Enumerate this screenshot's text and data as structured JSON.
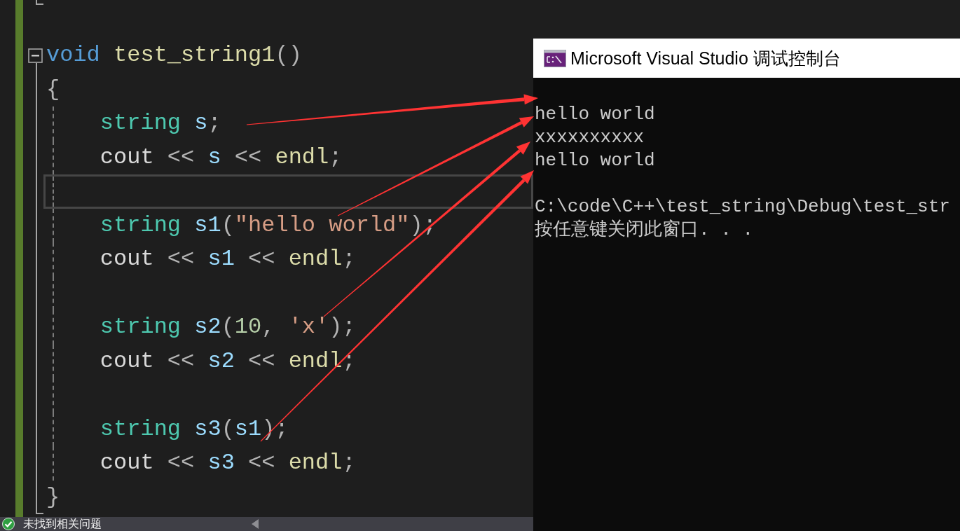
{
  "editor": {
    "lines": [
      {
        "kind": "fold_end",
        "current": false
      },
      {
        "kind": "code",
        "current": false
      },
      {
        "kind": "fold_start",
        "expanded": true,
        "tokens": [
          {
            "kind": "keyword",
            "text": "void"
          },
          {
            "kind": "function",
            "text": " test_string1"
          },
          {
            "kind": "punct",
            "text": "()"
          }
        ],
        "current": false
      },
      {
        "kind": "code",
        "tokens": [
          {
            "kind": "punct",
            "text": "{"
          }
        ],
        "current": false,
        "children": [
          {
            "kind": "code",
            "tokens": [
              {
                "kind": "type",
                "text": "string"
              },
              {
                "kind": "variable",
                "text": " s"
              },
              {
                "kind": "punct",
                "text": ";"
              }
            ],
            "current": false
          },
          {
            "kind": "code",
            "tokens": [
              {
                "kind": "identifier",
                "text": "cout"
              },
              {
                "kind": "operator",
                "text": " << "
              },
              {
                "kind": "variable",
                "text": "s"
              },
              {
                "kind": "operator",
                "text": " << "
              },
              {
                "kind": "function",
                "text": "endl"
              },
              {
                "kind": "punct",
                "text": ";"
              }
            ],
            "current": false
          },
          {
            "kind": "code",
            "current": true
          },
          {
            "kind": "code",
            "tokens": [
              {
                "kind": "type",
                "text": "string"
              },
              {
                "kind": "variable",
                "text": " s1"
              },
              {
                "kind": "punct",
                "text": "("
              },
              {
                "kind": "string",
                "text": "\"hello world\""
              },
              {
                "kind": "punct",
                "text": ");"
              }
            ],
            "current": false
          },
          {
            "kind": "code",
            "tokens": [
              {
                "kind": "identifier",
                "text": "cout"
              },
              {
                "kind": "operator",
                "text": " << "
              },
              {
                "kind": "variable",
                "text": "s1"
              },
              {
                "kind": "operator",
                "text": " << "
              },
              {
                "kind": "function",
                "text": "endl"
              },
              {
                "kind": "punct",
                "text": ";"
              }
            ],
            "current": false
          },
          {
            "kind": "code",
            "current": false
          },
          {
            "kind": "code",
            "tokens": [
              {
                "kind": "type",
                "text": "string"
              },
              {
                "kind": "variable",
                "text": " s2"
              },
              {
                "kind": "punct",
                "text": "("
              },
              {
                "kind": "number",
                "text": "10"
              },
              {
                "kind": "punct",
                "text": ", "
              },
              {
                "kind": "string",
                "text": "'x'"
              },
              {
                "kind": "punct",
                "text": ");"
              }
            ],
            "current": false
          },
          {
            "kind": "code",
            "tokens": [
              {
                "kind": "identifier",
                "text": "cout"
              },
              {
                "kind": "operator",
                "text": " << "
              },
              {
                "kind": "variable",
                "text": "s2"
              },
              {
                "kind": "operator",
                "text": " << "
              },
              {
                "kind": "function",
                "text": "endl"
              },
              {
                "kind": "punct",
                "text": ";"
              }
            ],
            "current": false
          },
          {
            "kind": "code",
            "current": false
          },
          {
            "kind": "code",
            "tokens": [
              {
                "kind": "type",
                "text": "string"
              },
              {
                "kind": "variable",
                "text": " s3"
              },
              {
                "kind": "punct",
                "text": "("
              },
              {
                "kind": "variable",
                "text": "s1"
              },
              {
                "kind": "punct",
                "text": ");"
              }
            ],
            "current": false
          },
          {
            "kind": "code",
            "tokens": [
              {
                "kind": "identifier",
                "text": "cout"
              },
              {
                "kind": "operator",
                "text": " << "
              },
              {
                "kind": "variable",
                "text": "s3"
              },
              {
                "kind": "operator",
                "text": " << "
              },
              {
                "kind": "function",
                "text": "endl"
              },
              {
                "kind": "punct",
                "text": ";"
              }
            ],
            "current": false
          }
        ]
      },
      {
        "kind": "fold_end",
        "tokens": [
          {
            "kind": "punct",
            "text": "}"
          }
        ],
        "current": false
      }
    ]
  },
  "console": {
    "title": "Microsoft Visual Studio 调试控制台",
    "lines": [
      {
        "kind": "blank"
      },
      {
        "kind": "text",
        "text": "hello world"
      },
      {
        "kind": "text",
        "text": "xxxxxxxxxx"
      },
      {
        "kind": "text",
        "text": "hello world"
      },
      {
        "kind": "blank"
      },
      {
        "kind": "text",
        "text": "C:\\code\\C++\\test_string\\Debug\\test_str"
      },
      {
        "kind": "text",
        "text": "按任意键关闭此窗口. . ."
      }
    ]
  },
  "status_bar": {
    "message": "未找到相关问题"
  }
}
